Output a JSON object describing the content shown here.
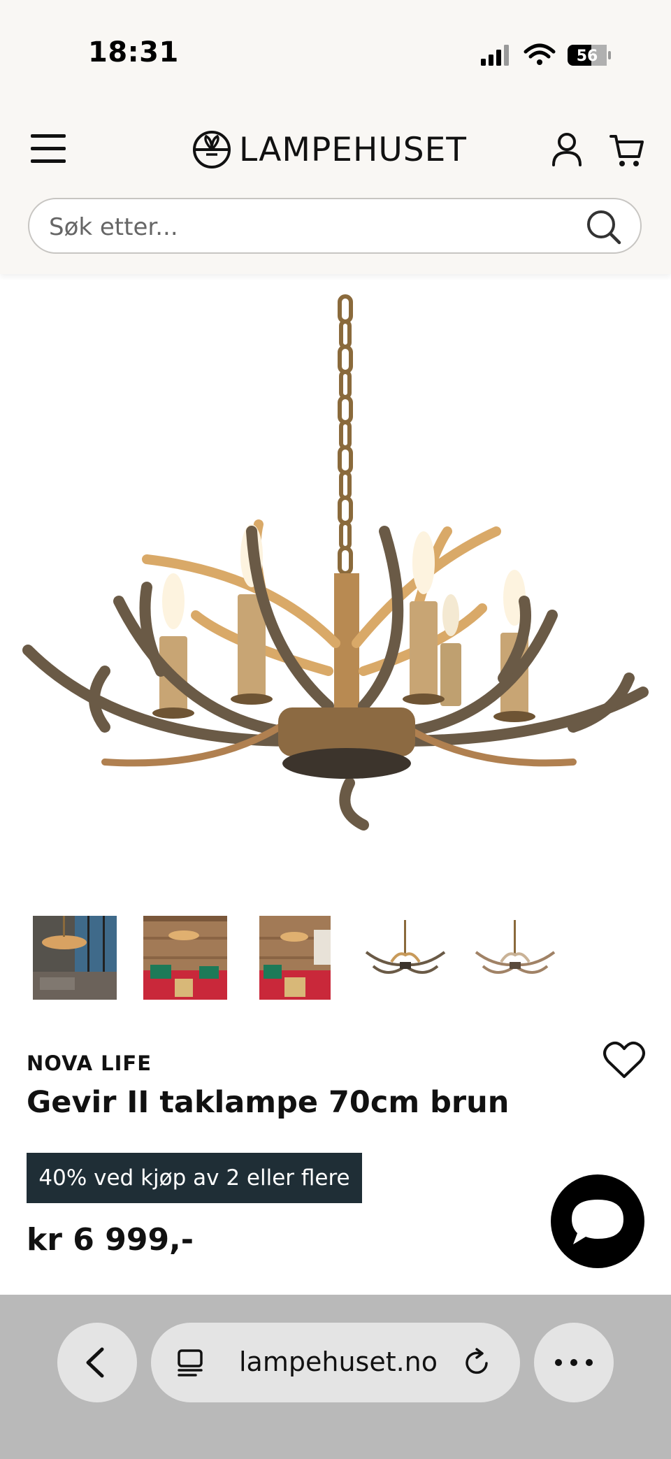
{
  "status_bar": {
    "time": "18:31",
    "battery": "56"
  },
  "header": {
    "logo_text": "LAMPEHUSET",
    "search": {
      "placeholder": "Søk etter..."
    }
  },
  "icons": {
    "menu": "hamburger-menu-icon",
    "logo": "lampehuset-logo-icon",
    "account": "user-icon",
    "cart": "cart-icon",
    "search": "search-icon",
    "favorite": "heart-icon",
    "chat": "chat-icon",
    "back": "chevron-left-icon",
    "tabs": "tab-switcher-icon",
    "reload": "reload-icon",
    "more": "more-icon"
  },
  "gallery": {
    "thumbnails": [
      {
        "alt": "living room with chandelier"
      },
      {
        "alt": "red sofa room"
      },
      {
        "alt": "red sofa room 2"
      },
      {
        "alt": "chandelier product 1"
      },
      {
        "alt": "chandelier product 2"
      }
    ]
  },
  "product": {
    "brand": "NOVA LIFE",
    "title": "Gevir II taklampe 70cm brun",
    "promo": "40% ved kjøp av 2 eller flere",
    "price": "kr 6 999,-"
  },
  "browser": {
    "url": "lampehuset.no"
  },
  "colors": {
    "header_bg": "#f9f7f4",
    "promo_bg": "#1f2e36",
    "bar_bg": "#b9b9b9"
  }
}
